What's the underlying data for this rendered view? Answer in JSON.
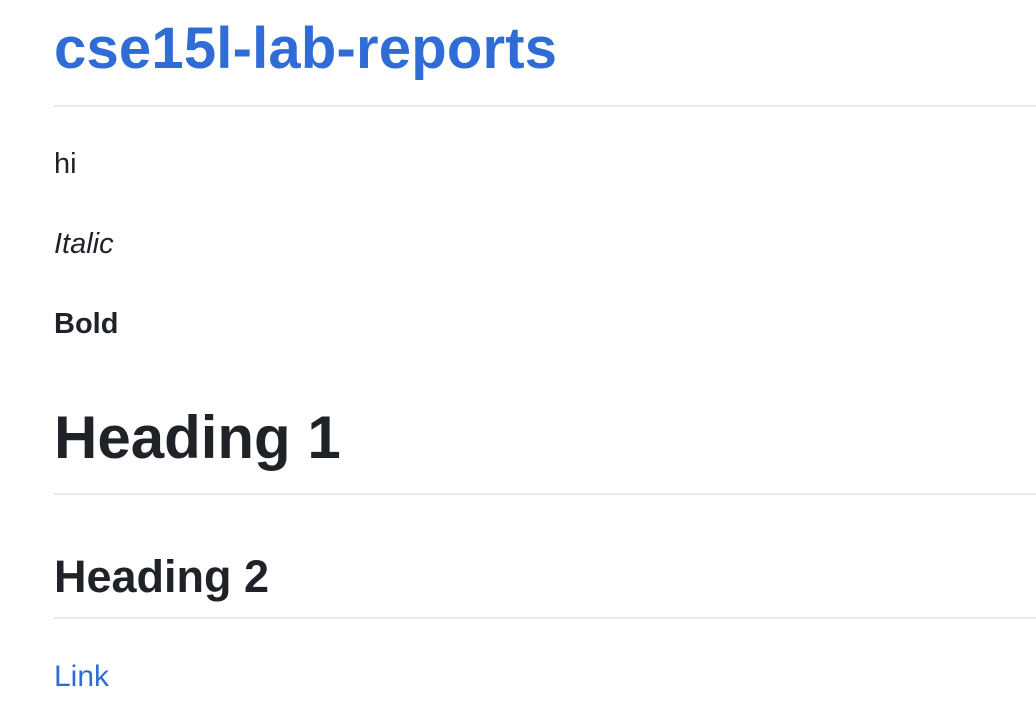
{
  "site": {
    "title": "cse15l-lab-reports"
  },
  "content": {
    "paragraph_plain": "hi",
    "paragraph_italic": "Italic",
    "paragraph_bold": "Bold",
    "heading_1": "Heading 1",
    "heading_2": "Heading 2",
    "link_text": "Link"
  },
  "colors": {
    "link_blue": "#2f6cd6",
    "text": "#1f2328",
    "rule": "#e7e8ea"
  }
}
